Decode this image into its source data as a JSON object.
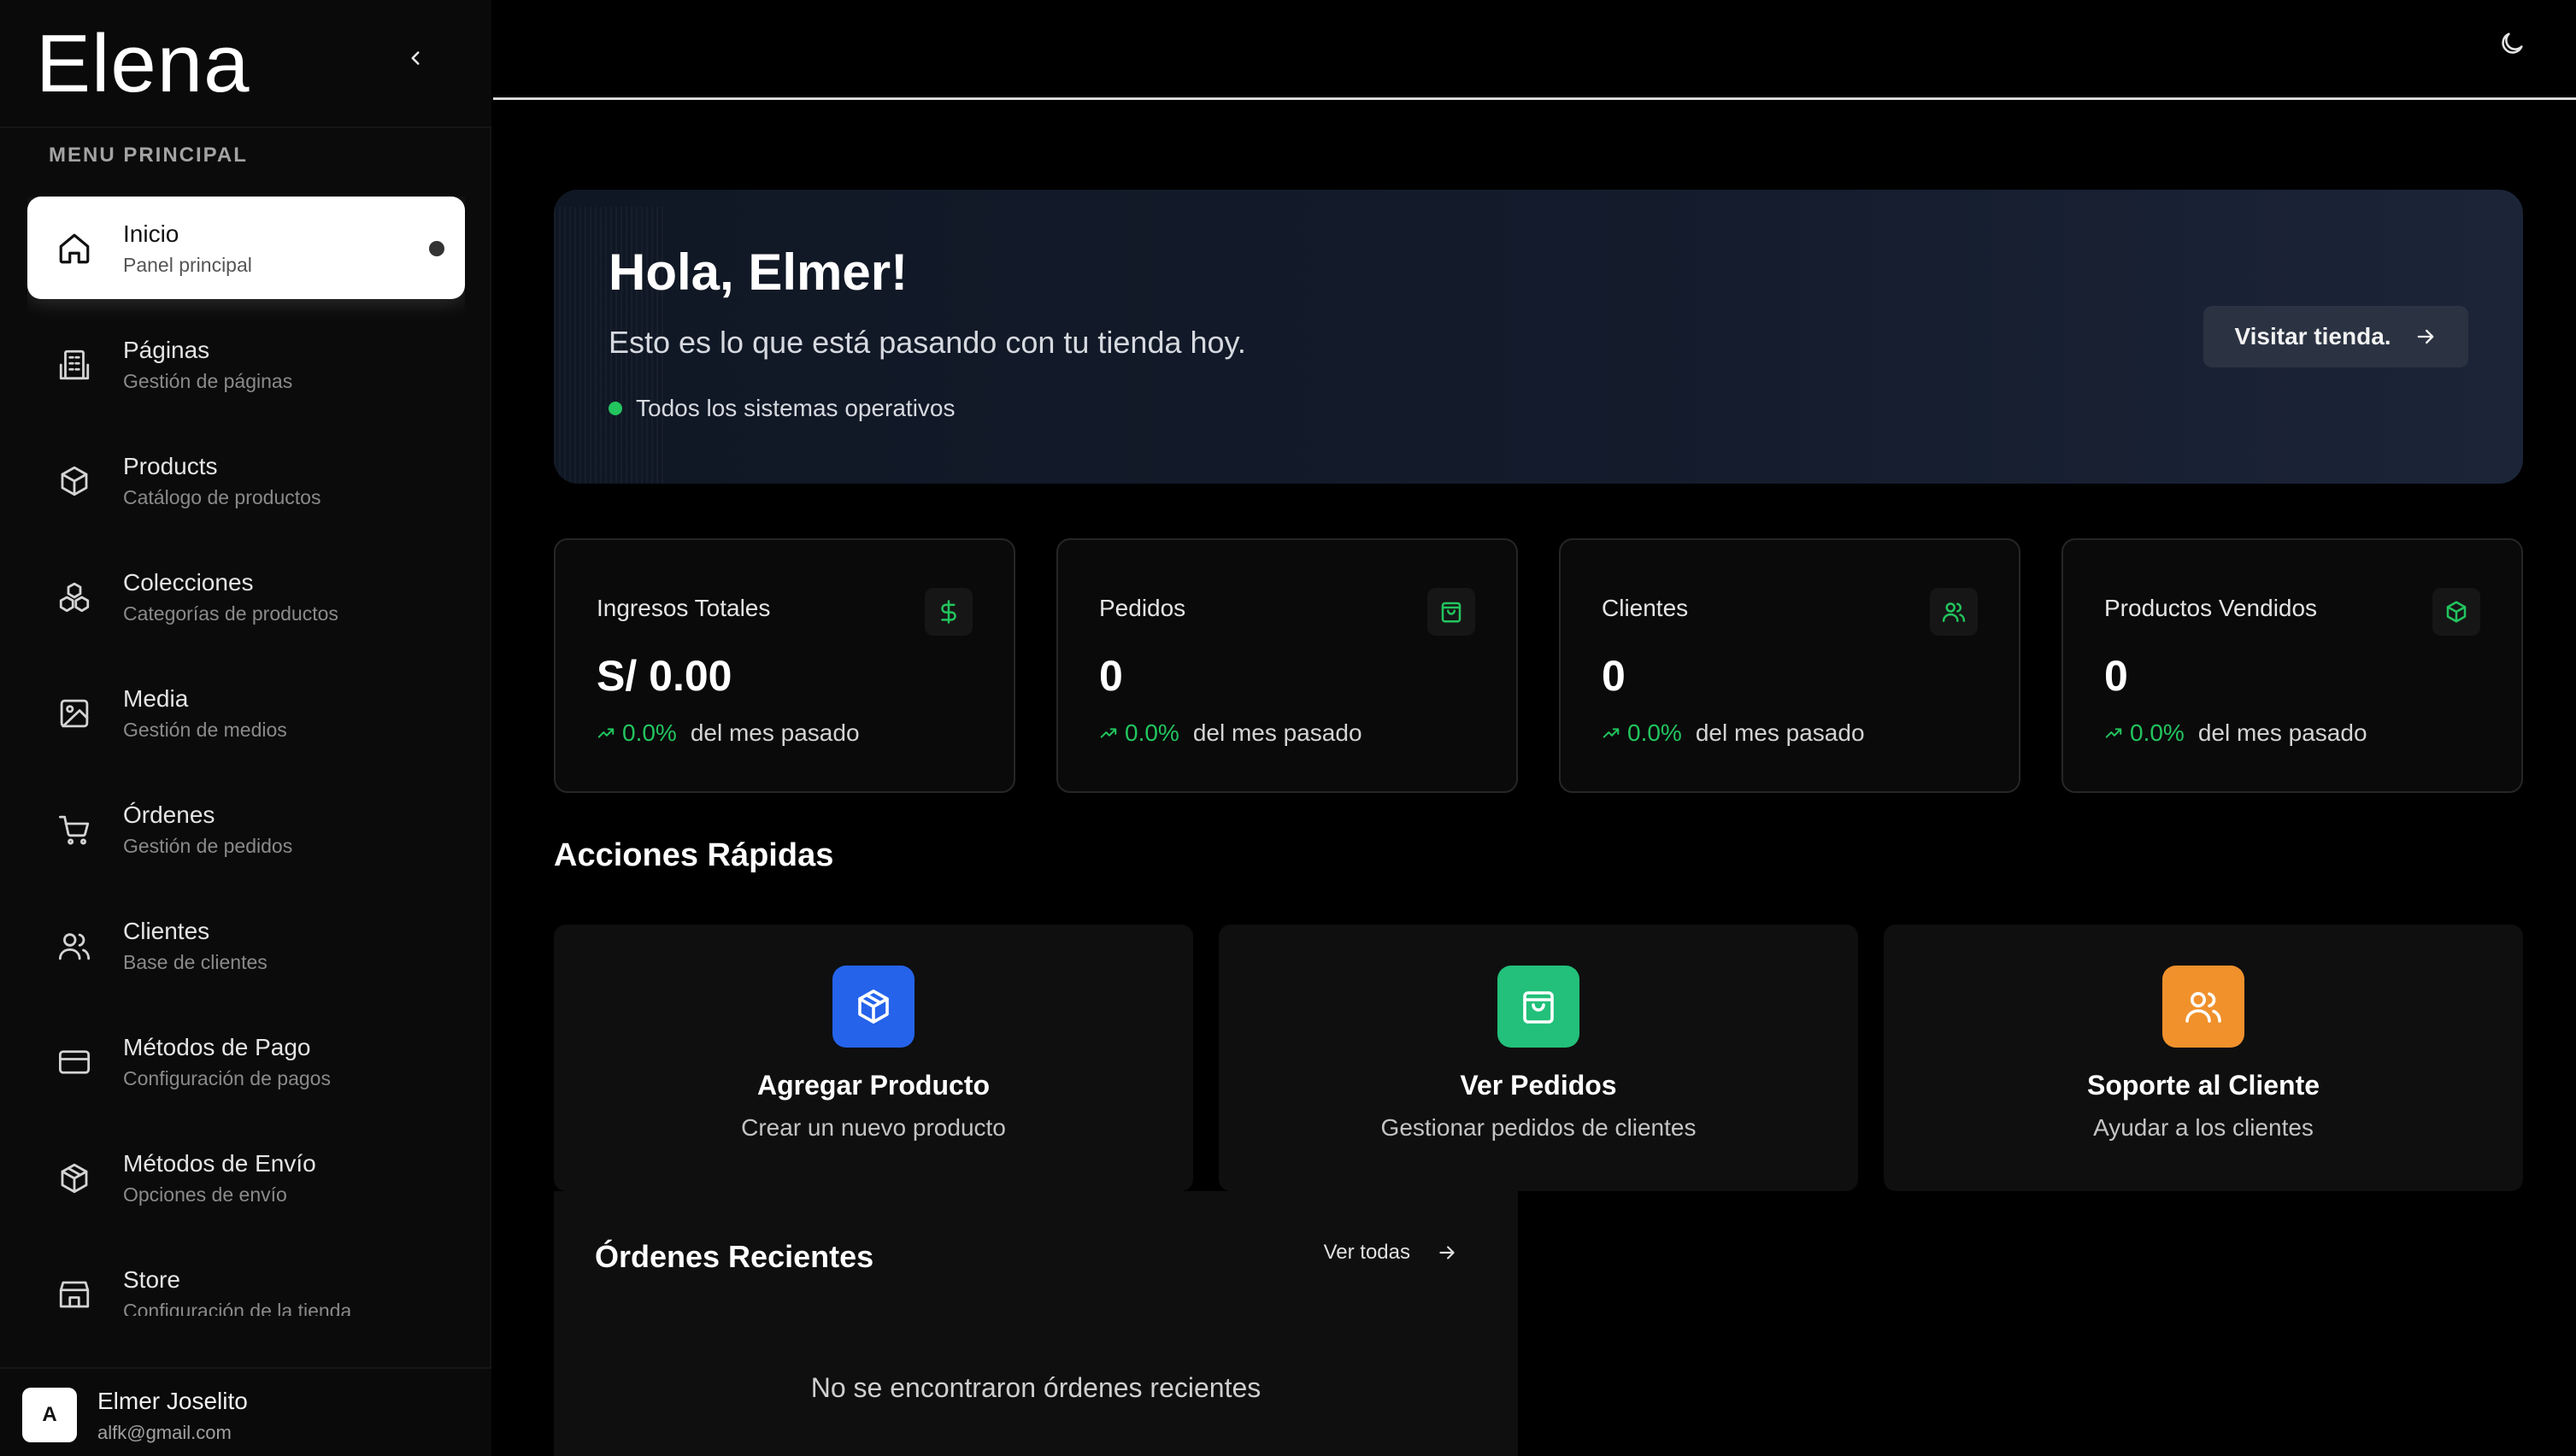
{
  "brand": {
    "name": "Elena"
  },
  "sidebar": {
    "menu_title": "MENU PRINCIPAL",
    "items": [
      {
        "label": "Inicio",
        "sub": "Panel principal",
        "icon": "home-icon",
        "active": true
      },
      {
        "label": "Páginas",
        "sub": "Gestión de páginas",
        "icon": "building-icon"
      },
      {
        "label": "Products",
        "sub": "Catálogo de productos",
        "icon": "package-icon"
      },
      {
        "label": "Colecciones",
        "sub": "Categorías de productos",
        "icon": "boxes-icon"
      },
      {
        "label": "Media",
        "sub": "Gestión de medios",
        "icon": "image-icon"
      },
      {
        "label": "Órdenes",
        "sub": "Gestión de pedidos",
        "icon": "cart-icon"
      },
      {
        "label": "Clientes",
        "sub": "Base de clientes",
        "icon": "users-icon"
      },
      {
        "label": "Métodos de Pago",
        "sub": "Configuración de pagos",
        "icon": "credit-card-icon"
      },
      {
        "label": "Métodos de Envío",
        "sub": "Opciones de envío",
        "icon": "package-icon"
      },
      {
        "label": "Store",
        "sub": "Configuración de la tienda",
        "icon": "store-icon"
      }
    ]
  },
  "user": {
    "initial": "A",
    "name": "Elmer Joselito",
    "email": "alfk@gmail.com"
  },
  "hero": {
    "title": "Hola, Elmer!",
    "subtitle": "Esto es lo que está pasando con tu tienda hoy.",
    "status": "Todos los sistemas operativos",
    "button": "Visitar tienda."
  },
  "stats": [
    {
      "title": "Ingresos Totales",
      "value": "S/ 0.00",
      "pct": "0.0%",
      "since": "del mes pasado",
      "icon": "dollar-icon"
    },
    {
      "title": "Pedidos",
      "value": "0",
      "pct": "0.0%",
      "since": "del mes pasado",
      "icon": "shopping-bag-icon"
    },
    {
      "title": "Clientes",
      "value": "0",
      "pct": "0.0%",
      "since": "del mes pasado",
      "icon": "users-icon"
    },
    {
      "title": "Productos Vendidos",
      "value": "0",
      "pct": "0.0%",
      "since": "del mes pasado",
      "icon": "package-icon"
    }
  ],
  "quick_actions": {
    "title": "Acciones Rápidas",
    "items": [
      {
        "title": "Agregar Producto",
        "sub": "Crear un nuevo producto",
        "color": "#2563eb",
        "icon": "package-icon"
      },
      {
        "title": "Ver Pedidos",
        "sub": "Gestionar pedidos de clientes",
        "color": "#22c07a",
        "icon": "shopping-bag-icon"
      },
      {
        "title": "Soporte al Cliente",
        "sub": "Ayudar a los clientes",
        "color": "#f0912c",
        "icon": "users-icon"
      }
    ]
  },
  "recent_orders": {
    "title": "Órdenes Recientes",
    "see_all": "Ver todas",
    "empty": "No se encontraron órdenes recientes"
  },
  "colors": {
    "accent_green": "#22c55e",
    "background": "#000000",
    "card": "#0a0a0a"
  }
}
